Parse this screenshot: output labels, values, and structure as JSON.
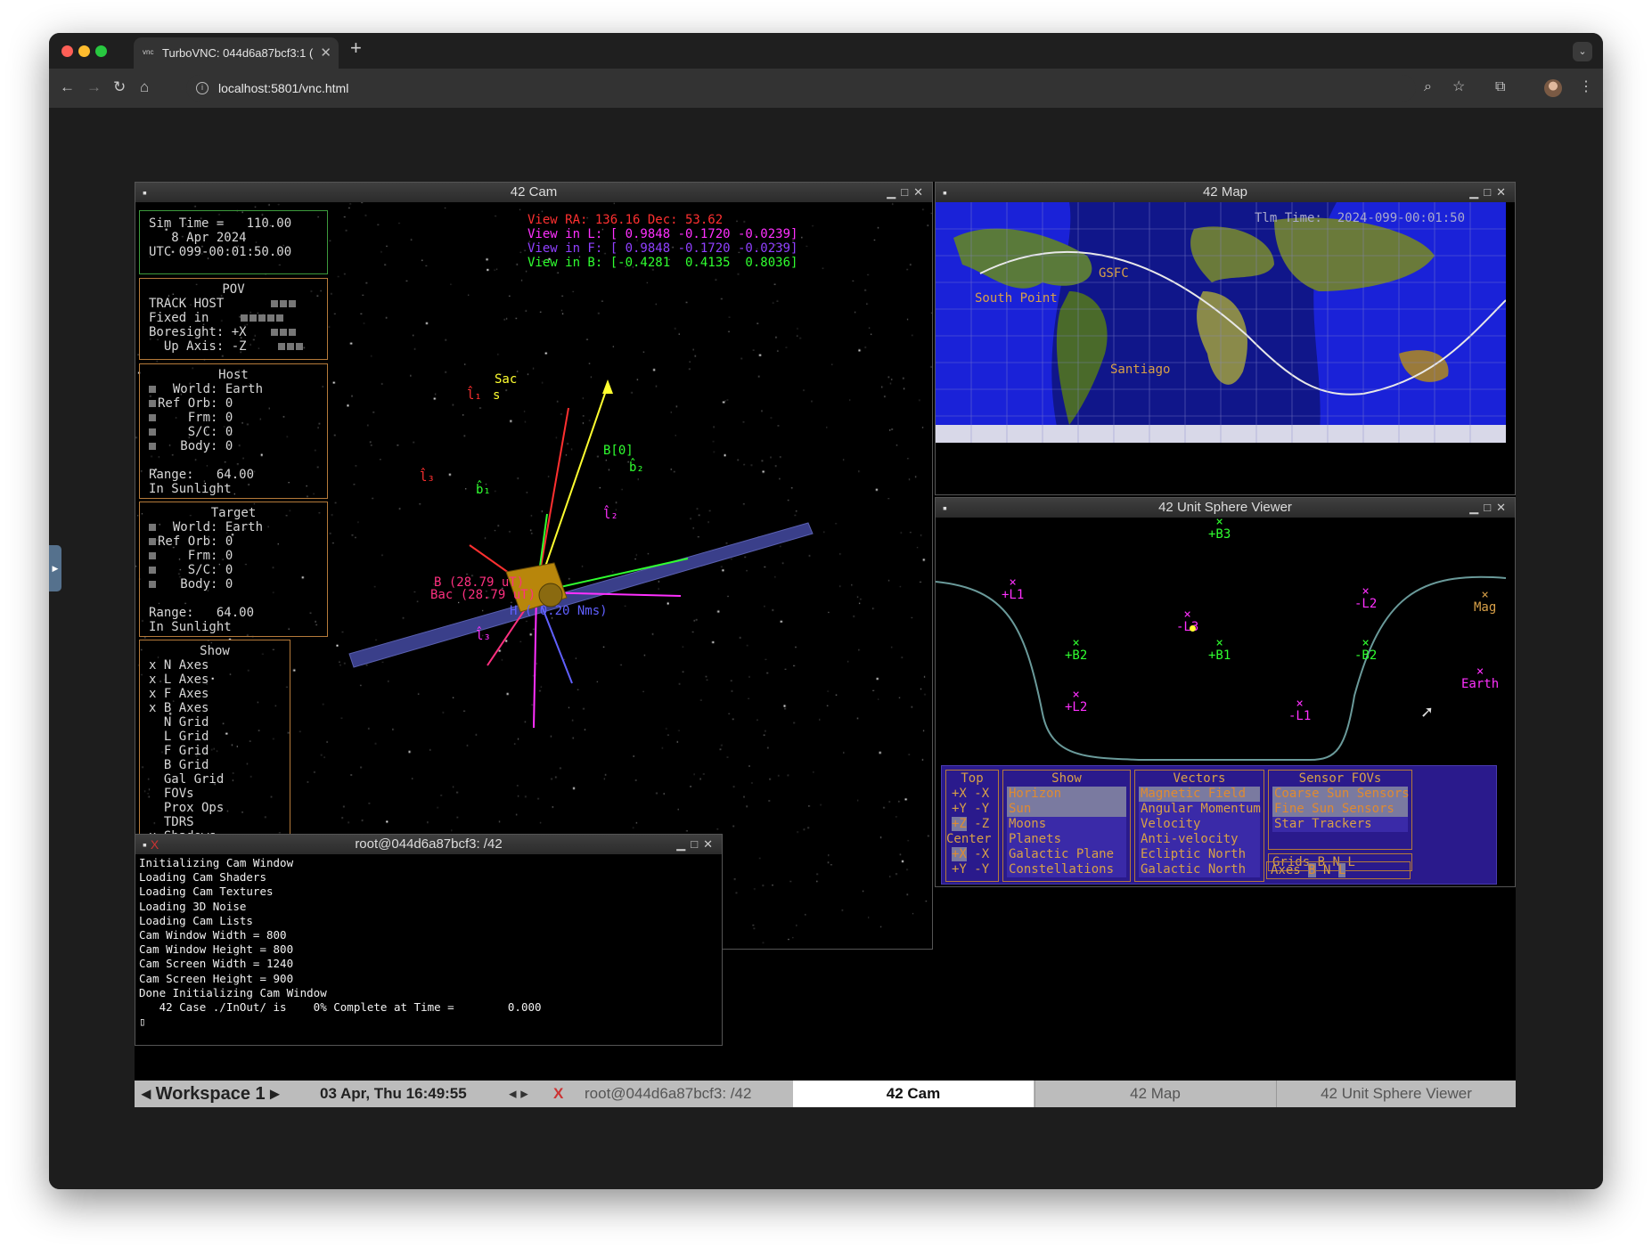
{
  "browser": {
    "tab_title": "TurboVNC: 044d6a87bcf3:1 (",
    "favicon": "vnc",
    "url": "localhost:5801/vnc.html",
    "icons": [
      "back-icon",
      "forward-icon",
      "reload-icon",
      "home-icon",
      "zoom-icon",
      "star-icon",
      "extensions-icon",
      "profile-icon",
      "menu-icon"
    ]
  },
  "cam": {
    "title": "42 Cam",
    "sim_time": [
      "Sim Time =   110.00",
      "   8 Apr 2024",
      "UTC 099-00:01:50.00"
    ],
    "pov": {
      "header": "POV",
      "rows": [
        "TRACK HOST",
        "Fixed in",
        "Boresight: +X",
        "  Up Axis: -Z"
      ]
    },
    "host": {
      "header": "Host",
      "rows": [
        "  World: Earth",
        "Ref Orb: 0",
        "    Frm: 0",
        "    S/C: 0",
        "   Body: 0"
      ],
      "range": "Range:   64.00",
      "sun": "In Sunlight"
    },
    "target": {
      "header": "Target",
      "rows": [
        "  World: Earth",
        "Ref Orb: 0",
        "    Frm: 0",
        "    S/C: 0",
        "   Body: 0"
      ],
      "range": "Range:   64.00",
      "sun": "In Sunlight"
    },
    "show": {
      "header": "Show",
      "rows": [
        "x N Axes",
        "x L Axes",
        "x F Axes",
        "x B Axes",
        "  N Grid",
        "  L Grid",
        "  F Grid",
        "  B Grid",
        "  Gal Grid",
        "  FOVs",
        "  Prox Ops",
        "  TDRS",
        "x Shadows"
      ]
    },
    "view": {
      "ra": "View RA: 136.16 Dec: 53.62",
      "l": "View in L: [ 0.9848 -0.1720 -0.0239]",
      "f": "View in F: [ 0.9848 -0.1720 -0.0239]",
      "b": "View in B: [-0.4281  0.4135  0.8036]"
    },
    "labels": {
      "sac": "Sac",
      "s": "s",
      "l1": "l̂₁",
      "l3": "l̂₃",
      "l2": "l̂₂",
      "l3b": "l̂₃",
      "b1": "b̂₁",
      "b2": "b̂₂",
      "b0": "B[0]",
      "bmag": "B (28.79 uT)",
      "bac": "Bac (28.79 uT)",
      "h": "H ( 0.20 Nms)"
    },
    "colors": {
      "red": "#ff3030",
      "yellow": "#ffff30",
      "green": "#30ff30",
      "magenta": "#ff30ff",
      "blue": "#6060ff",
      "orange": "#ff8030"
    }
  },
  "map": {
    "title": "42 Map",
    "tlm": "Tlm Time:  2024-099-00:01:50",
    "labels": [
      "GSFC",
      "South Point",
      "Santiago"
    ]
  },
  "sphere": {
    "title": "42 Unit Sphere Viewer",
    "points": [
      {
        "label": "+B3",
        "color": "green"
      },
      {
        "label": "+L1",
        "color": "magenta"
      },
      {
        "label": "-L2",
        "color": "magenta"
      },
      {
        "label": "Mag",
        "color": "orange"
      },
      {
        "label": "-L3",
        "color": "magenta"
      },
      {
        "label": "+B2",
        "color": "green"
      },
      {
        "label": "+B1",
        "color": "green"
      },
      {
        "label": "-B2",
        "color": "green"
      },
      {
        "label": "Earth",
        "color": "magenta"
      },
      {
        "label": "+L2",
        "color": "magenta"
      },
      {
        "label": "-L1",
        "color": "magenta"
      }
    ],
    "top": {
      "header": "Top",
      "rows": [
        [
          "+X",
          "-X"
        ],
        [
          "+Y",
          "-Y"
        ],
        [
          "+Z",
          "-Z"
        ]
      ],
      "center": "Center",
      "crows": [
        [
          "+X",
          "-X"
        ],
        [
          "+Y",
          "-Y"
        ]
      ]
    },
    "show": {
      "header": "Show",
      "items": [
        "Horizon",
        "Sun",
        "Moons",
        "Planets",
        "Galactic Plane",
        "Constellations"
      ]
    },
    "vectors": {
      "header": "Vectors",
      "items": [
        "Magnetic Field",
        "Angular Momentum",
        "Velocity",
        "Anti-velocity",
        "Ecliptic North",
        "Galactic North"
      ]
    },
    "sensors": {
      "header": "Sensor FOVs",
      "items": [
        "Coarse Sun Sensors",
        "Fine Sun Sensors",
        "Star Trackers"
      ],
      "grids": "Grids",
      "axes": "Axes",
      "bnl": [
        "B",
        "N",
        "L"
      ]
    }
  },
  "terminal": {
    "title": "root@044d6a87bcf3: /42",
    "lines": [
      "Initializing Cam Window",
      "Loading Cam Shaders",
      "Loading Cam Textures",
      "Loading 3D Noise",
      "Loading Cam Lists",
      "Cam Window Width = 800",
      "Cam Window Height = 800",
      "Cam Screen Width = 1240",
      "Cam Screen Height = 900",
      "Done Initializing Cam Window",
      "   42 Case ./InOut/ is    0% Complete at Time =        0.000",
      "▯"
    ]
  },
  "taskbar": {
    "workspace": "Workspace 1",
    "clock": "03 Apr, Thu 16:49:55",
    "tasks": [
      "root@044d6a87bcf3: /42",
      "42 Cam",
      "42 Map",
      "42 Unit Sphere Viewer"
    ],
    "active_task": "42 Cam"
  }
}
